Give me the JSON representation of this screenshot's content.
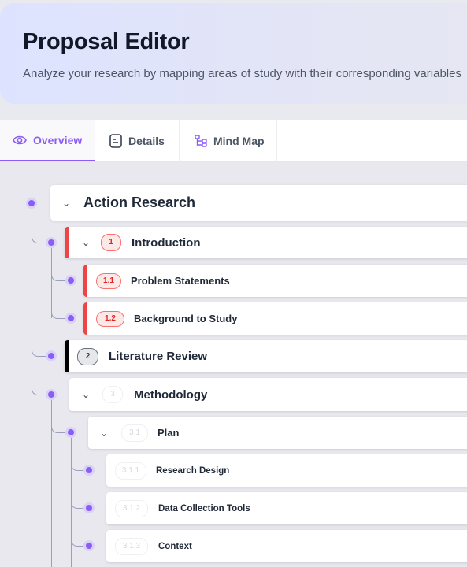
{
  "header": {
    "title": "Proposal Editor",
    "subtitle": "Analyze your research by mapping areas of study with their corresponding variables"
  },
  "tabs": [
    {
      "label": "Overview",
      "icon": "eye-icon",
      "active": true
    },
    {
      "label": "Details",
      "icon": "document-icon",
      "active": false
    },
    {
      "label": "Mind Map",
      "icon": "mind-map-icon",
      "active": false
    }
  ],
  "tree": {
    "root": {
      "label": "Action Research",
      "expanded": true
    },
    "nodes": [
      {
        "number": "1",
        "label": "Introduction",
        "expanded": true,
        "accent": "#ef4444"
      },
      {
        "number": "1.1",
        "label": "Problem Statements",
        "accent": "#ef4444"
      },
      {
        "number": "1.2",
        "label": "Background to Study",
        "accent": "#ef4444"
      },
      {
        "number": "2",
        "label": "Literature Review",
        "accent": "#000000"
      },
      {
        "number": "3",
        "label": "Methodology",
        "expanded": true
      },
      {
        "number": "3.1",
        "label": "Plan",
        "expanded": true
      },
      {
        "number": "3.1.1",
        "label": "Research Design"
      },
      {
        "number": "3.1.2",
        "label": "Data Collection Tools"
      },
      {
        "number": "3.1.3",
        "label": "Context"
      }
    ]
  },
  "colors": {
    "accent": "#8b5cf6",
    "red": "#ef4444",
    "connector": "#9aa0b8"
  }
}
